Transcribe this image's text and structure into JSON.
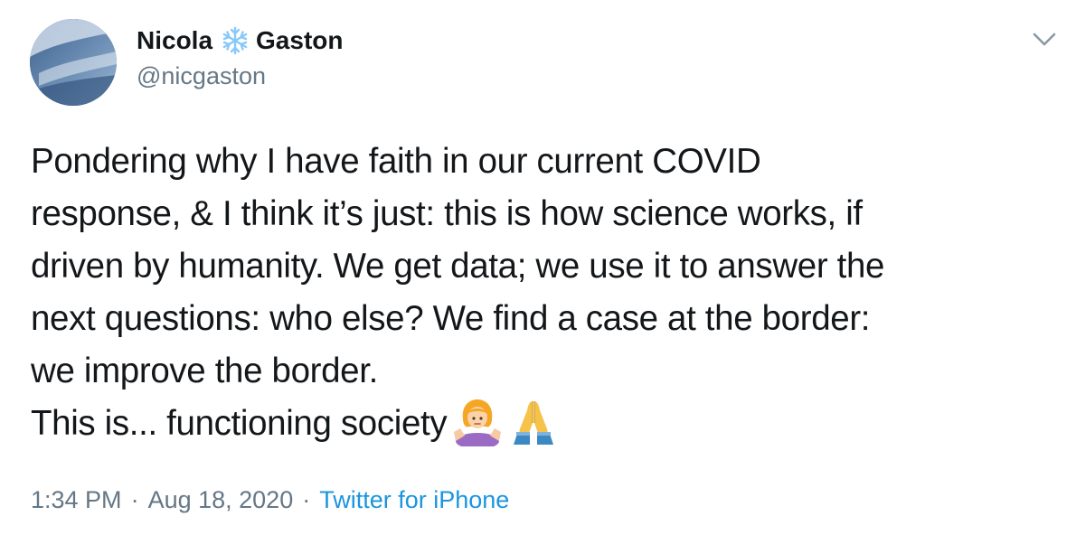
{
  "author": {
    "name_first": "Nicola",
    "name_last": "Gaston",
    "handle": "@nicgaston",
    "name_emoji": "snowflake-icon"
  },
  "tweet": {
    "lines": [
      "Pondering why I have faith in our current COVID",
      "response, & I think it’s just: this is how science works, if",
      "driven by humanity. We get data; we use it to answer the",
      "next questions: who else? We find a case at the border:",
      "we improve the border.",
      "This is... functioning society"
    ],
    "trailing_emoji": [
      "person-shrugging-icon",
      "folded-hands-icon"
    ]
  },
  "meta": {
    "time": "1:34 PM",
    "separator": "·",
    "date": "Aug 18, 2020",
    "source": "Twitter for iPhone"
  },
  "colors": {
    "text": "#14171a",
    "secondary": "#657786",
    "link": "#1b95e0",
    "snowflake": "#88c9f9"
  }
}
